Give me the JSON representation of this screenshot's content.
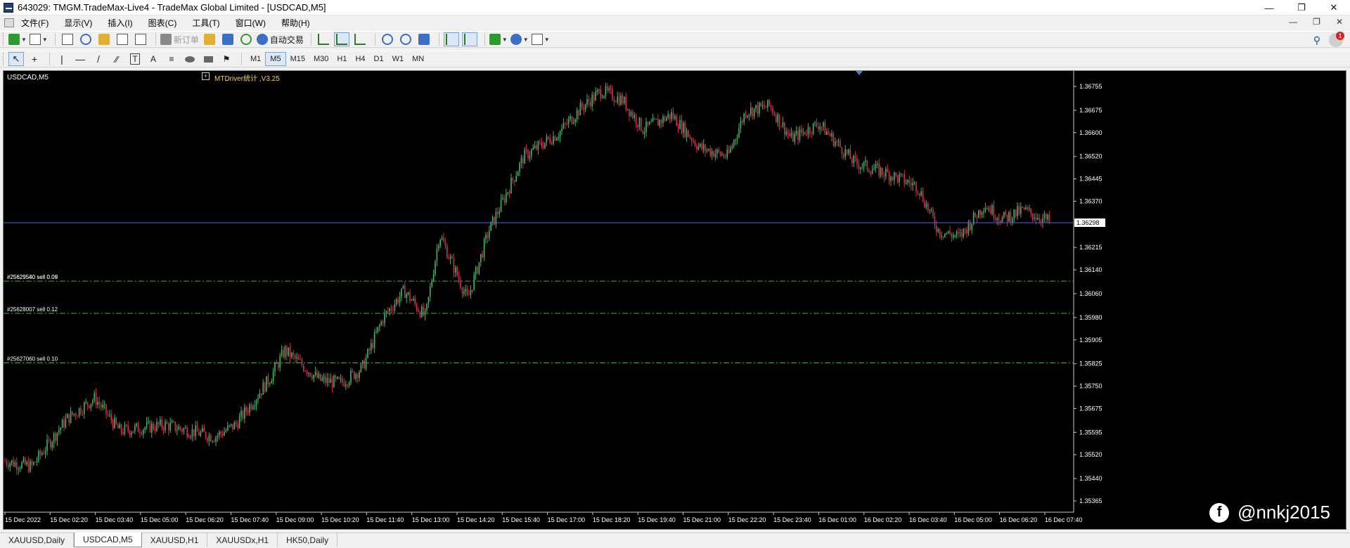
{
  "window": {
    "title": "643029: TMGM.TradeMax-Live4 - TradeMax Global Limited - [USDCAD,M5]",
    "controls": [
      "—",
      "❐",
      "✕"
    ]
  },
  "menu": {
    "items": [
      "文件(F)",
      "显示(V)",
      "插入(I)",
      "图表(C)",
      "工具(T)",
      "窗口(W)",
      "帮助(H)"
    ],
    "mdi_controls": [
      "—",
      "❐",
      "✕"
    ]
  },
  "toolbar": {
    "new_order": "新订单",
    "auto_trading": "自动交易"
  },
  "timeframes": {
    "items": [
      "M1",
      "M5",
      "M15",
      "M30",
      "H1",
      "H4",
      "D1",
      "W1",
      "MN"
    ],
    "active": "M5"
  },
  "chart": {
    "symbol_label": "USDCAD,M5",
    "indicator_label": "MTDriver统计 ,V3.25",
    "indicator_plus": "+",
    "bg_color": "#000000",
    "bull_color": "#48b26b",
    "bear_color": "#d0304a",
    "bid_line_color": "#4169e1",
    "order_line_color": "#5a9a5a",
    "bid_price": "1.36298",
    "price_axis": [
      "1.36755",
      "1.36675",
      "1.36600",
      "1.36520",
      "1.36445",
      "1.36370",
      "1.36215",
      "1.36140",
      "1.36060",
      "1.35980",
      "1.35905",
      "1.35825",
      "1.35750",
      "1.35675",
      "1.35595",
      "1.35520",
      "1.35440",
      "1.35365"
    ],
    "time_axis": [
      "15 Dec 2022",
      "15 Dec 02:20",
      "15 Dec 03:40",
      "15 Dec 05:00",
      "15 Dec 06:20",
      "15 Dec 07:40",
      "15 Dec 09:00",
      "15 Dec 10:20",
      "15 Dec 11:40",
      "15 Dec 13:00",
      "15 Dec 14:20",
      "15 Dec 15:40",
      "15 Dec 17:00",
      "15 Dec 18:20",
      "15 Dec 19:40",
      "15 Dec 21:00",
      "15 Dec 22:20",
      "15 Dec 23:40",
      "16 Dec 01:00",
      "16 Dec 02:20",
      "16 Dec 03:40",
      "16 Dec 05:00",
      "16 Dec 06:20",
      "16 Dec 07:40"
    ],
    "orders": [
      {
        "label": "#25629540 sell 0.09",
        "price": 1.36102
      },
      {
        "label": "#25628007 sell 0.12",
        "price": 1.35994
      },
      {
        "label": "#25627060 sell 0.10",
        "price": 1.35828
      }
    ],
    "order_overlap_label": "#25629560 sell 0.08"
  },
  "tabs": {
    "items": [
      "XAUUSD,Daily",
      "USDCAD,M5",
      "XAUUSD,H1",
      "XAUUSDx,H1",
      "HK50,Daily"
    ],
    "active": "USDCAD,M5"
  },
  "watermark": {
    "text": "@nnkj2015",
    "icon": "facebook-icon"
  }
}
